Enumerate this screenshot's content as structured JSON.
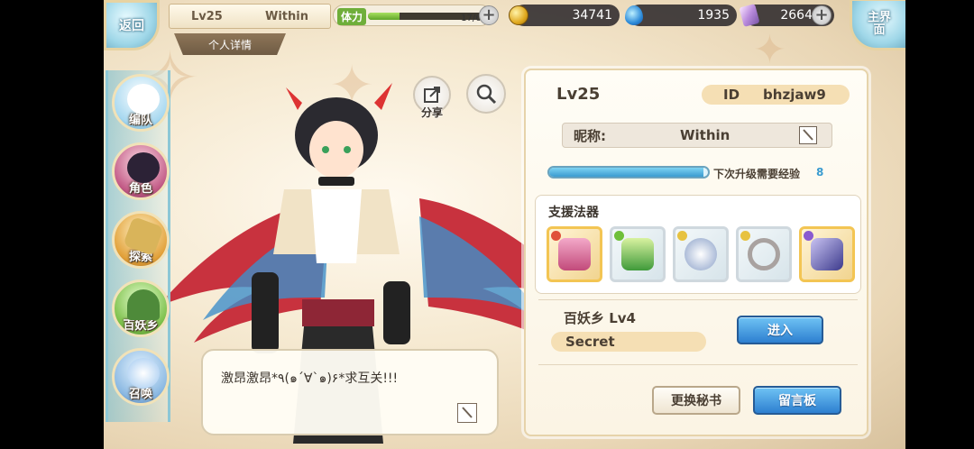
{
  "top_bar": {
    "back_label": "返回",
    "player_level": "Lv25",
    "player_name": "Within",
    "detail_label": "个人详情",
    "stamina_label": "体力",
    "stamina_value": "17/64",
    "stamina_fraction": 0.27,
    "coins": "34741",
    "gems": "1935",
    "crystals": "2664",
    "home_label": "主界面"
  },
  "left_nav": {
    "items": [
      {
        "label": "编队",
        "icon": "team-icon"
      },
      {
        "label": "角色",
        "icon": "character-icon"
      },
      {
        "label": "探索",
        "icon": "explore-icon"
      },
      {
        "label": "百妖乡",
        "icon": "village-icon"
      },
      {
        "label": "召唤",
        "icon": "summon-icon"
      }
    ]
  },
  "character": {
    "share_label": "分享",
    "speech_text": "激昂激昂*٩(๑´∀`๑)۶*求互关!!!"
  },
  "panel": {
    "level": "Lv25",
    "id_label": "ID",
    "id_value": "bhzjaw9",
    "nickname_label": "昵称:",
    "nickname_value": "Within",
    "exp_label": "下次升级需要经验",
    "exp_value": "8",
    "exp_fraction": 0.97,
    "support_title": "支援法器",
    "artifacts": [
      "artifact-potion-icon",
      "artifact-scroll-icon",
      "artifact-orb-icon",
      "artifact-ring-icon",
      "artifact-sword-icon"
    ],
    "village_label": "百妖乡  Lv4",
    "village_name": "Secret",
    "enter_label": "进入",
    "change_secretary_label": "更换秘书",
    "message_board_label": "留言板"
  },
  "colors": {
    "accent_blue": "#2d7fd0",
    "panel_bg": "#fffdf6",
    "gold_border": "#f3c553"
  }
}
